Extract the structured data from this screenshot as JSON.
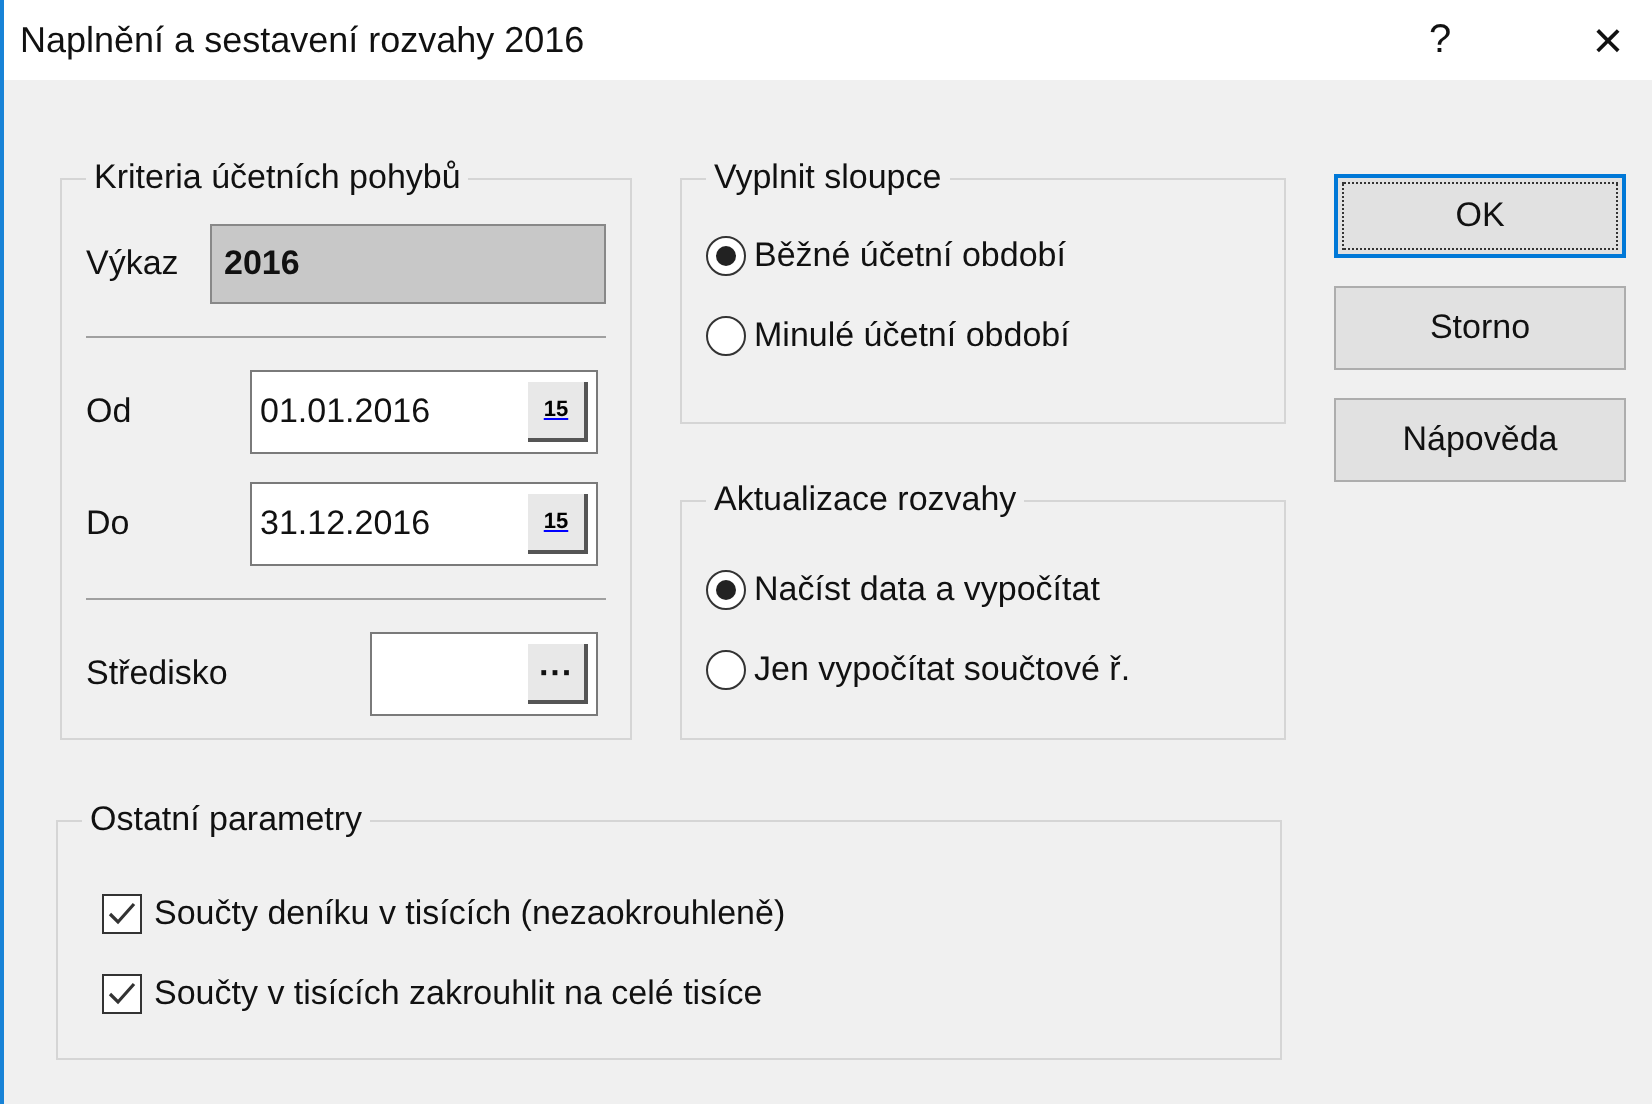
{
  "window": {
    "title": "Naplnění a sestavení rozvahy 2016",
    "help": "?",
    "close": "×"
  },
  "criteria": {
    "title": "Kriteria účetních pohybů",
    "report_label": "Výkaz",
    "report_value": "2016",
    "from_label": "Od",
    "from_value": "01.01.2016",
    "from_calendar_text": "15",
    "to_label": "Do",
    "to_value": "31.12.2016",
    "to_calendar_text": "15",
    "center_label": "Středisko",
    "center_button": "···"
  },
  "fill_columns": {
    "title": "Vyplnit sloupce",
    "options": [
      {
        "label": "Běžné účetní období",
        "selected": true
      },
      {
        "label": "Minulé účetní období",
        "selected": false
      }
    ]
  },
  "update": {
    "title": "Aktualizace rozvahy",
    "options": [
      {
        "label": "Načíst data a vypočítat",
        "selected": true
      },
      {
        "label": "Jen vypočítat součtové ř.",
        "selected": false
      }
    ]
  },
  "buttons": [
    {
      "label": "OK",
      "focused": true
    },
    {
      "label": "Storno",
      "focused": false
    },
    {
      "label": "Nápověda",
      "focused": false
    }
  ],
  "other": {
    "title": "Ostatní parametry",
    "options": [
      {
        "label": "Součty deníku v tisících (nezaokrouhleně)",
        "checked": true
      },
      {
        "label": "Součty v tisících zakrouhlit na celé tisíce",
        "checked": true
      }
    ]
  }
}
